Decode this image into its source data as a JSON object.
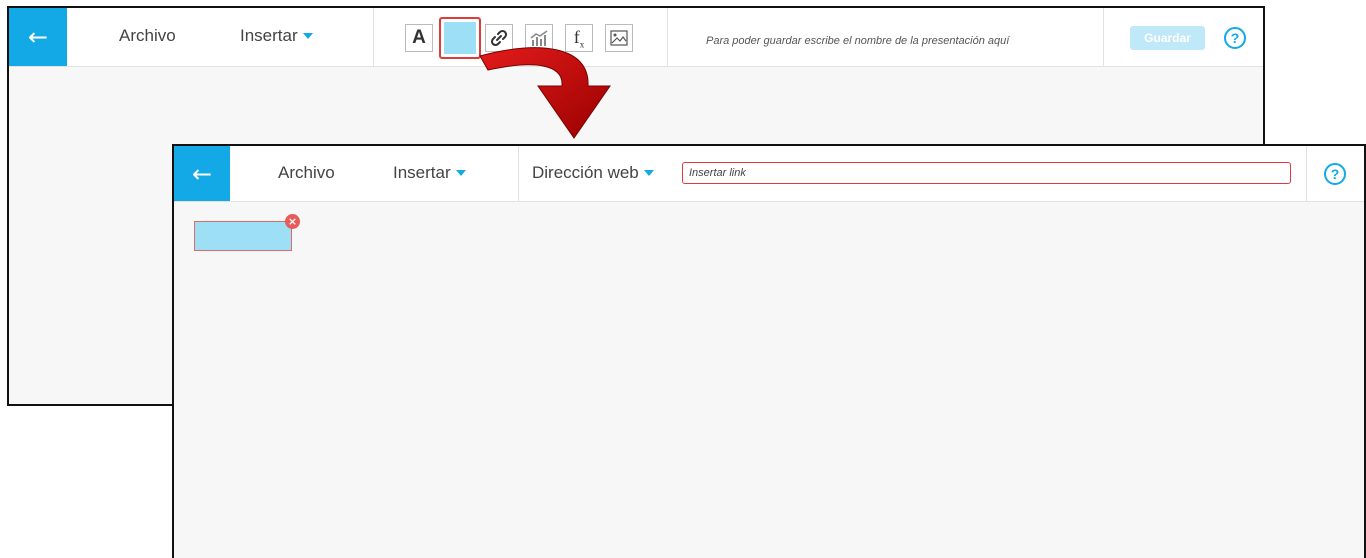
{
  "back_window": {
    "back_icon": "arrow-left-icon",
    "menu": {
      "archivo": "Archivo",
      "insertar": "Insertar"
    },
    "tools": {
      "text_glyph": "A",
      "shape_color": "#9ddff5",
      "link_icon": "link-icon",
      "chart_icon": "chart-icon",
      "formula_glyph": "f",
      "formula_sub": "x",
      "image_icon": "image-icon"
    },
    "hint": "Para poder guardar escribe el nombre de la presentación aquí",
    "save_label": "Guardar",
    "help_glyph": "?"
  },
  "front_window": {
    "back_icon": "arrow-left-icon",
    "menu": {
      "archivo": "Archivo",
      "insertar": "Insertar",
      "direccion_web": "Dirección web"
    },
    "link_placeholder": "Insertar link",
    "help_glyph": "?",
    "box_close_glyph": "×"
  },
  "colors": {
    "accent": "#12a9e6",
    "highlight": "#e03b3b",
    "shape_fill": "#9ddff5",
    "arrow": "#c40000"
  }
}
